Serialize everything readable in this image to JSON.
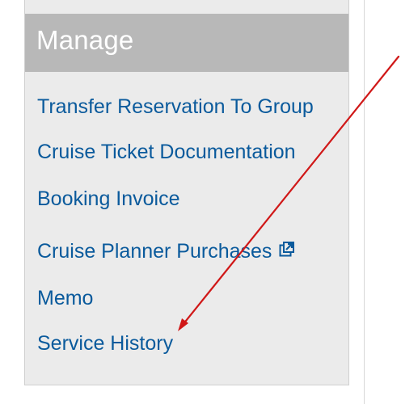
{
  "manage_panel": {
    "title": "Manage",
    "links": [
      {
        "label": "Transfer Reservation To Group"
      },
      {
        "label": "Cruise Ticket Documentation"
      },
      {
        "label": "Booking Invoice"
      },
      {
        "label": "Cruise Planner Purchases",
        "icon": "external-link-icon"
      },
      {
        "label": "Memo"
      },
      {
        "label": "Service History"
      }
    ]
  },
  "annotation": {
    "arrow_color": "#d01818",
    "target": "Service History"
  },
  "colors": {
    "panel_background": "#ebebeb",
    "header_background": "#b8b8b8",
    "header_text": "#ffffff",
    "link": "#0a5a9c"
  }
}
